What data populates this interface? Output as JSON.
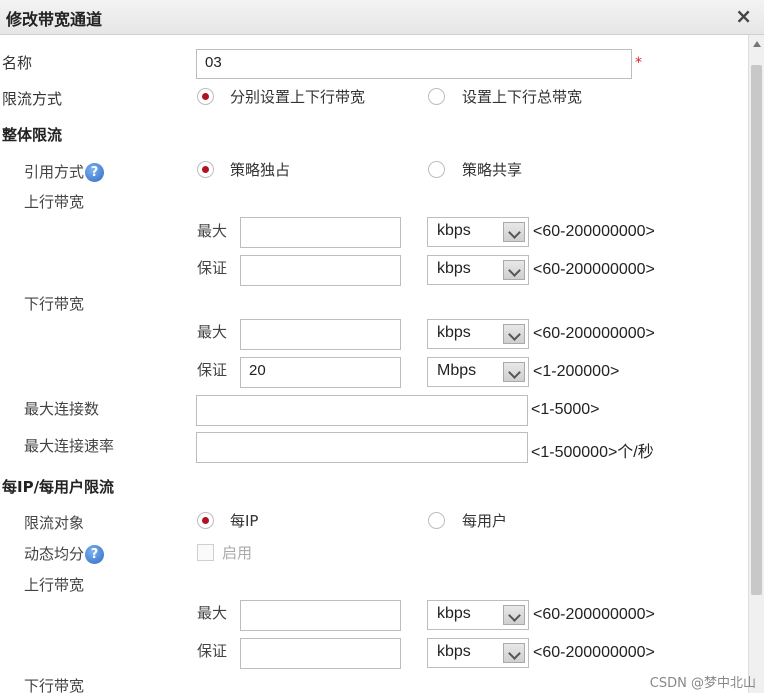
{
  "dialog": {
    "title": "修改带宽通道",
    "close_glyph": "×"
  },
  "name": {
    "label": "名称",
    "value": "03",
    "required_mark": "*"
  },
  "limit_mode": {
    "label": "限流方式",
    "option1": "分别设置上下行带宽",
    "option2": "设置上下行总带宽",
    "selected": "option1"
  },
  "overall": {
    "heading": "整体限流",
    "ref_mode": {
      "label": "引用方式",
      "option1": "策略独占",
      "option2": "策略共享",
      "selected": "option1"
    },
    "upstream": {
      "label": "上行带宽",
      "max": {
        "label": "最大",
        "value": "",
        "unit": "kbps",
        "range": "<60-200000000>"
      },
      "guarantee": {
        "label": "保证",
        "value": "",
        "unit": "kbps",
        "range": "<60-200000000>"
      }
    },
    "downstream": {
      "label": "下行带宽",
      "max": {
        "label": "最大",
        "value": "",
        "unit": "kbps",
        "range": "<60-200000000>"
      },
      "guarantee": {
        "label": "保证",
        "value": "20",
        "unit": "Mbps",
        "range": "<1-200000>"
      }
    },
    "max_conn": {
      "label": "最大连接数",
      "value": "",
      "range": "<1-5000>"
    },
    "max_conn_rate": {
      "label": "最大连接速率",
      "value": "",
      "range": "<1-500000>个/秒"
    }
  },
  "per_ip": {
    "heading": "每IP/每用户限流",
    "target": {
      "label": "限流对象",
      "option1": "每IP",
      "option2": "每用户",
      "selected": "option1"
    },
    "dynamic_share": {
      "label": "动态均分",
      "checkbox_label": "启用",
      "checked": false,
      "disabled": true
    },
    "upstream": {
      "label": "上行带宽",
      "max": {
        "label": "最大",
        "value": "",
        "unit": "kbps",
        "range": "<60-200000000>"
      },
      "guarantee": {
        "label": "保证",
        "value": "",
        "unit": "kbps",
        "range": "<60-200000000>"
      }
    },
    "downstream_label": "下行带宽"
  },
  "help_glyph": "?",
  "watermark": "CSDN @梦中北山",
  "colors": {
    "radio_selected": "#b1141f",
    "required": "#e02020",
    "help_icon": "#2d6ac4"
  }
}
